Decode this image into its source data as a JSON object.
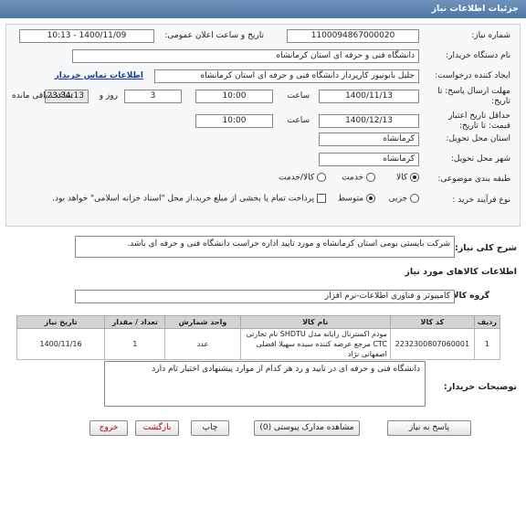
{
  "header": {
    "title": "جزئیات اطلاعات نیاز"
  },
  "form": {
    "need_number_label": "شماره نیاز:",
    "need_number": "1100094867000020",
    "announce_label": "تاریخ و ساعت اعلان عمومی:",
    "announce_value": "1400/11/09 - 10:13",
    "buyer_label": "نام دستگاه خریدار:",
    "buyer_value": "دانشگاه فنی و حرفه ای استان کرمانشاه",
    "creator_label": "ایجاد کننده درخواست:",
    "creator_value": "جلیل  بابونیور کارپرداز دانشگاه فنی و حرفه ای استان کرمانشاه",
    "contact_link": "اطلاعات تماس خریدار",
    "deadline_label_1": "مهلت ارسال پاسخ: تا",
    "deadline_label_2": "تاریخ:",
    "deadline_date": "1400/11/13",
    "time_label": "ساعت",
    "deadline_time": "10:00",
    "days_value": "3",
    "days_label": "روز و",
    "remaining_time": "23:34:13",
    "remaining_label": "ساعت باقی مانده",
    "validity_label_1": "حداقل تاریخ اعتبار",
    "validity_label_2": "قیمت: تا تاریخ:",
    "validity_date": "1400/12/13",
    "validity_time_label": "ساعت",
    "validity_time": "10:00",
    "province_label": "استان محل تحویل:",
    "province_value": "کرمانشاه",
    "city_label": "شهر محل تحویل:",
    "city_value": "کرمانشاه",
    "category_label": "طبقه بندی موضوعی:",
    "category_options": [
      "کالا",
      "خدمت",
      "کالا/خدمت"
    ],
    "category_selected": 0,
    "process_label": "نوع فرآیند خرید :",
    "process_options": [
      "جزیی",
      "متوسط"
    ],
    "process_selected": 1,
    "payment_note": "پرداخت تمام یا بخشی از مبلغ خرید،از محل \"اسناد خزانه اسلامی\" خواهد بود."
  },
  "description": {
    "label": "شرح کلی نیاز:",
    "text": "شرکت بایستی بومی استان کرمانشاه و مورد تایید اداره حراست دانشگاه فنی و حرفه ای باشد."
  },
  "goods": {
    "section_title": "اطلاعات کالاهای مورد نیاز",
    "group_label": "گروه کالا:",
    "group_value": "کامپیوتر و فناوری اطلاعات-نرم افزار",
    "columns": [
      "ردیف",
      "کد کالا",
      "نام کالا",
      "واحد شمارش",
      "تعداد / مقدار",
      "تاریخ نیاز"
    ],
    "rows": [
      {
        "index": "1",
        "code": "2232300807060001",
        "name": "مودم اکسترنال رایانه مدل SHDTU نام تجارتی CTC مرجع عرضه کننده سیده سهیلا افضلی اصفهانی نژاد",
        "unit": "عدد",
        "qty": "1",
        "date": "1400/11/16"
      }
    ]
  },
  "buyer_notes": {
    "label": "توضیحات خریدار:",
    "text": "دانشگاه فنی و حرفه ای در تایید و رد هر کدام از موارد پیشنهادی اختیار تام دارد"
  },
  "buttons": {
    "reply": "پاسخ به نیاز",
    "attachments": "مشاهده مدارک پیوستی (0)",
    "print": "چاپ",
    "back": "بازگشت",
    "exit": "خروج"
  },
  "colors": {
    "header_bg": "#5a7fab",
    "exit_text": "#b00000",
    "link": "#1a3f9b"
  }
}
